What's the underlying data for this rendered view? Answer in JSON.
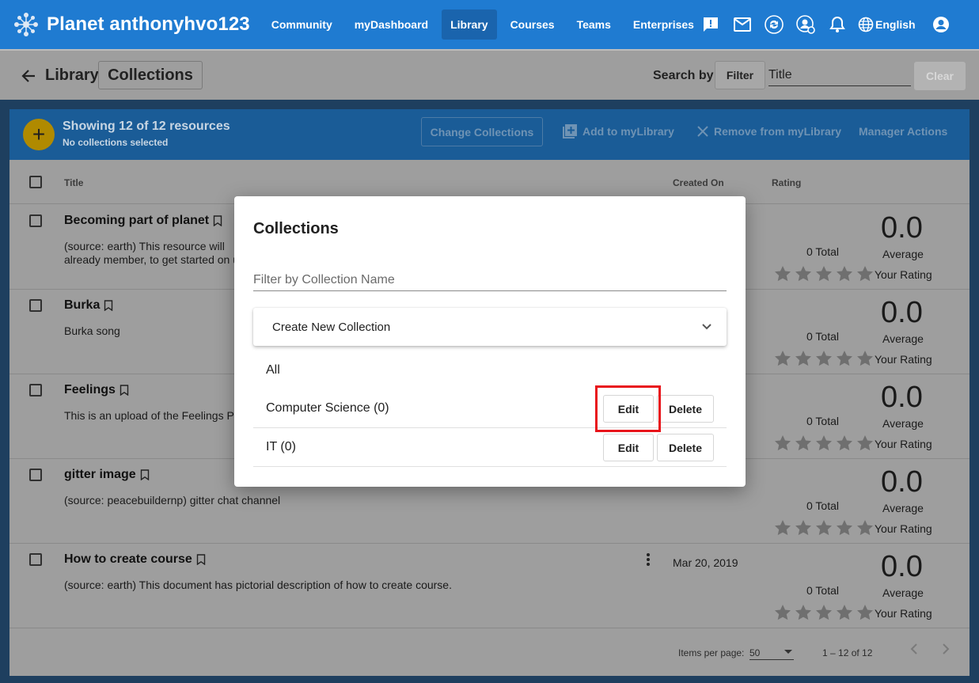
{
  "app": {
    "title": "Planet anthonyhvo123",
    "nav": [
      "Community",
      "myDashboard",
      "Library",
      "Courses",
      "Teams",
      "Enterprises"
    ],
    "active_nav": "Library",
    "language": "English",
    "icons": [
      "feedback-icon",
      "mail-icon",
      "sync-icon",
      "manager-settings-icon",
      "bell-icon",
      "globe-icon",
      "account-icon"
    ]
  },
  "header": {
    "breadcrumb_parent": "Library",
    "breadcrumb_current": "Collections",
    "search_label": "Search by:",
    "filter_button": "Filter",
    "search_value": "Title",
    "clear_button": "Clear"
  },
  "toolbar": {
    "showing": "Showing 12 of 12 resources",
    "selection": "No collections selected",
    "change_collections": "Change Collections",
    "add_to_library": "Add to myLibrary",
    "remove_from_library": "Remove from myLibrary",
    "manager_actions": "Manager Actions"
  },
  "table": {
    "columns": {
      "title": "Title",
      "created_on": "Created On",
      "rating": "Rating"
    },
    "rows": [
      {
        "title": "Becoming part of planet",
        "desc1": "(source: earth) This resource will",
        "desc2": "already member, to get started on u",
        "date": "",
        "total": "0 Total",
        "average": "0.0",
        "average_label": "Average",
        "your_rating": "Your Rating"
      },
      {
        "title": "Burka",
        "desc1": "Burka song",
        "desc2": "",
        "date": "",
        "total": "0 Total",
        "average": "0.0",
        "average_label": "Average",
        "your_rating": "Your Rating"
      },
      {
        "title": "Feelings",
        "desc1": "This is an upload of the Feelings Pl",
        "desc2": "",
        "date": "",
        "total": "0 Total",
        "average": "0.0",
        "average_label": "Average",
        "your_rating": "Your Rating"
      },
      {
        "title": "gitter image",
        "desc1": "(source: peacebuildernp) gitter chat channel",
        "desc2": "",
        "date": "",
        "total": "0 Total",
        "average": "0.0",
        "average_label": "Average",
        "your_rating": "Your Rating"
      },
      {
        "title": "How to create course",
        "desc1": "(source: earth) This document has pictorial description of how to create course.",
        "desc2": "",
        "date": "Mar 20, 2019",
        "total": "0 Total",
        "average": "0.0",
        "average_label": "Average",
        "your_rating": "Your Rating"
      }
    ]
  },
  "paginator": {
    "items_per_page_label": "Items per page:",
    "items_per_page": "50",
    "range": "1 – 12 of 12"
  },
  "dialog": {
    "title": "Collections",
    "filter_placeholder": "Filter by Collection Name",
    "create_new": "Create New Collection",
    "all": "All",
    "collections": [
      {
        "name": "Computer Science (0)",
        "edit": "Edit",
        "delete": "Delete"
      },
      {
        "name": "IT (0)",
        "edit": "Edit",
        "delete": "Delete"
      }
    ]
  },
  "colors": {
    "nav_blue": "#1f7bd1",
    "toolbar_dimmed": "#1a5c97",
    "accent_yellow": "#b08a00",
    "highlight_red": "#e8141b"
  }
}
